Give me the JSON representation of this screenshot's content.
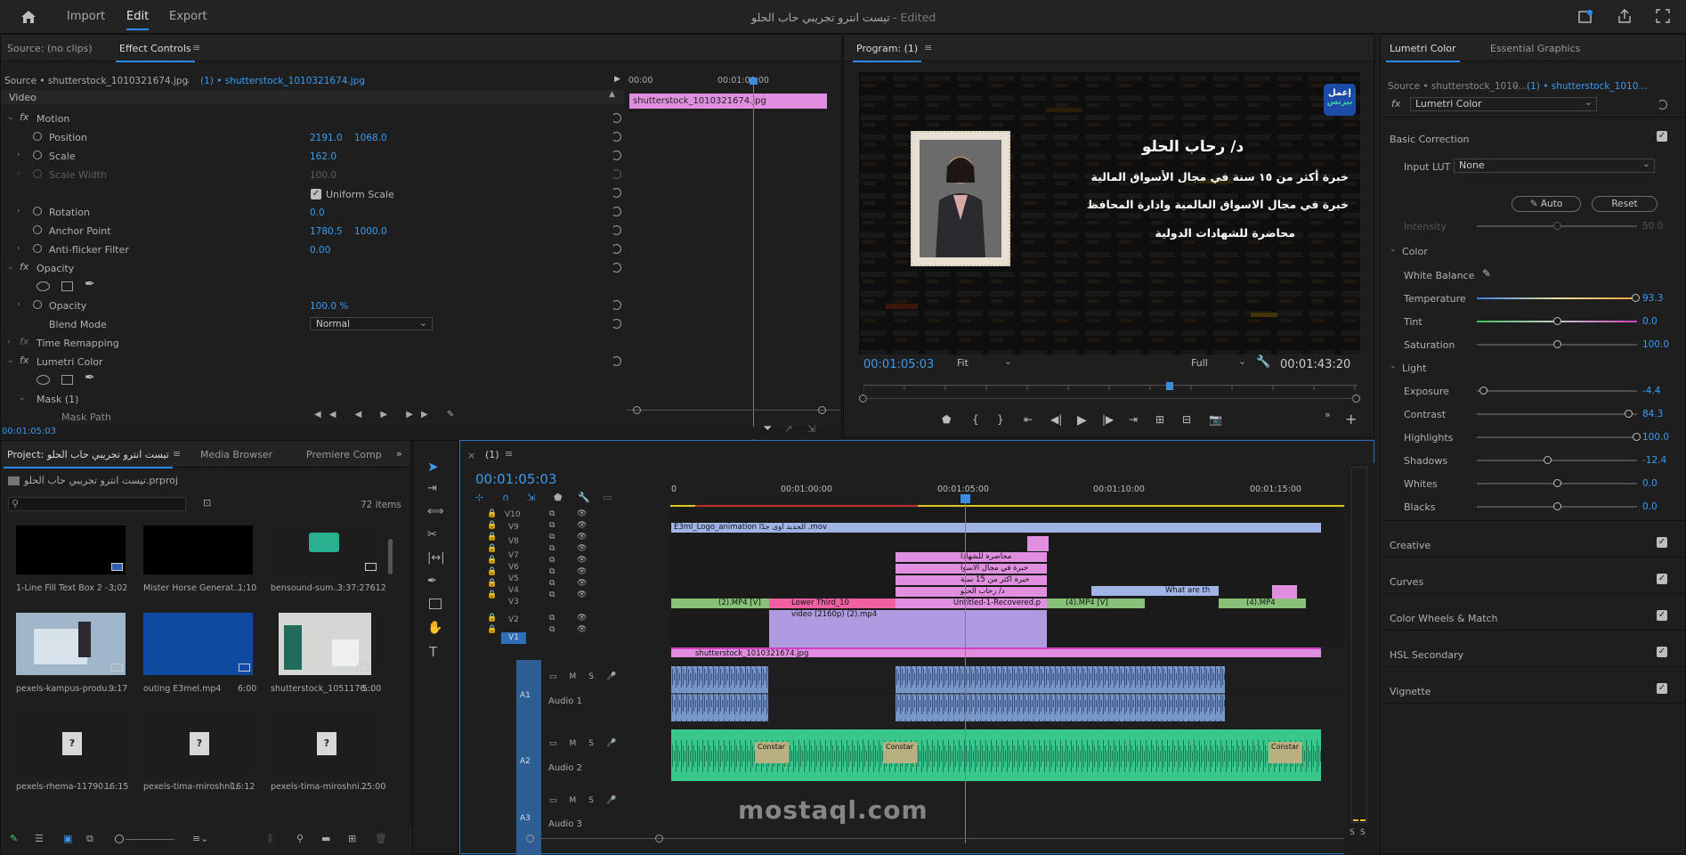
{
  "topbar": {
    "import": "Import",
    "edit": "Edit",
    "export": "Export",
    "title": "تيست انترو تجريبي حاب الحلو",
    "edited": "- Edited"
  },
  "source_panel": {
    "tab_source": "Source: (no clips)",
    "tab_effect": "Effect Controls",
    "source_label": "Source • shutterstock_1010321674.jpg",
    "seq_label": "(1) • shutterstock_1010321674.jpg",
    "time0": "00:00",
    "time1": "00:01:00:00",
    "video": "Video",
    "clip_name": "shutterstock_1010321674.jpg",
    "timecode": "00:01:05:03"
  },
  "effects": {
    "motion": "Motion",
    "position": "Position",
    "pos_x": "2191.0",
    "pos_y": "1068.0",
    "scale": "Scale",
    "scale_v": "162.0",
    "scale_width": "Scale Width",
    "scale_width_v": "100.0",
    "uniform": "Uniform Scale",
    "rotation": "Rotation",
    "rotation_v": "0.0",
    "anchor": "Anchor Point",
    "anchor_x": "1780.5",
    "anchor_y": "1000.0",
    "flicker": "Anti-flicker Filter",
    "flicker_v": "0.00",
    "opacity_grp": "Opacity",
    "opacity": "Opacity",
    "opacity_v": "100.0 %",
    "blend": "Blend Mode",
    "blend_v": "Normal",
    "remap": "Time Remapping",
    "lumetri": "Lumetri Color",
    "mask": "Mask (1)",
    "mask_path": "Mask Path"
  },
  "program": {
    "title": "Program: (1)",
    "name": "د/ رحاب الحلو",
    "line1": "خبرة أكثر من ١٥ سنة في مجال الأسواق المالية",
    "line2": "خبرة في مجال الاسواق العالمية وادارة المحافظ",
    "line3": "محاضرة للشهادات الدولية",
    "logo1": "إعمل",
    "logo2": "بيزنس",
    "timecode": "00:01:05:03",
    "fit": "Fit",
    "full": "Full",
    "duration": "00:01:43:20"
  },
  "lumetri": {
    "tab1": "Lumetri Color",
    "tab2": "Essential Graphics",
    "source": "Source • shutterstock_1010...",
    "seq": "(1) • shutterstock_1010...",
    "fx": "Lumetri Color",
    "basic": "Basic Correction",
    "input_lut": "Input LUT",
    "lut_v": "None",
    "auto": "Auto",
    "reset": "Reset",
    "intensity": "Intensity",
    "intensity_v": "50.0",
    "color": "Color",
    "white_balance": "White Balance",
    "temperature": "Temperature",
    "temperature_v": "93.3",
    "tint": "Tint",
    "tint_v": "0.0",
    "saturation": "Saturation",
    "saturation_v": "100.0",
    "light": "Light",
    "exposure": "Exposure",
    "exposure_v": "-4.4",
    "contrast": "Contrast",
    "contrast_v": "84.3",
    "highlights": "Highlights",
    "highlights_v": "100.0",
    "shadows": "Shadows",
    "shadows_v": "-12.4",
    "whites": "Whites",
    "whites_v": "0.0",
    "blacks": "Blacks",
    "blacks_v": "0.0",
    "creative": "Creative",
    "curves": "Curves",
    "wheels": "Color Wheels & Match",
    "hsl": "HSL Secondary",
    "vignette": "Vignette"
  },
  "project": {
    "tab1": "Project: تيست انترو تجريبي حاب الحلو",
    "tab2": "Media Browser",
    "tab3": "Premiere Comp",
    "file": "تيست انترو تجريبي حاب الحلو.prproj",
    "items": "72 items",
    "bins": [
      {
        "name": "1-Line Fill Text Box 2 -...",
        "dur": "3;02"
      },
      {
        "name": "Mister Horse Generat...",
        "dur": "1;10"
      },
      {
        "name": "bensound-sum...",
        "dur": "3:37:27612"
      },
      {
        "name": "pexels-kampus-produ...",
        "dur": "9:17"
      },
      {
        "name": "outing E3mel.mp4",
        "dur": "6:00"
      },
      {
        "name": "shutterstock_1051176...",
        "dur": "5:00"
      },
      {
        "name": "pexels-rhema-11790...",
        "dur": "16:15"
      },
      {
        "name": "pexels-tima-miroshni...",
        "dur": "16:12"
      },
      {
        "name": "pexels-tima-miroshni...",
        "dur": "25:00"
      }
    ]
  },
  "timeline": {
    "seq": "(1)",
    "timecode": "00:01:05:03",
    "r0": "0",
    "r1": "00:01:00:00",
    "r2": "00:01:05:00",
    "r3": "00:01:10:00",
    "r4": "00:01:15:00",
    "tracks": {
      "v10": "V10",
      "v9": "V9",
      "v8": "V8",
      "v7": "V7",
      "v6": "V6",
      "v5": "V5",
      "v4": "V4",
      "v3": "V3",
      "v2": "V2",
      "v1": "V1",
      "a1": "A1",
      "a2": "A2",
      "a3": "A3",
      "audio1": "Audio 1",
      "audio2": "Audio 2",
      "audio3": "Audio 3"
    },
    "clips": {
      "v10": "E3ml_Logo_animation الجديد أوى جدًا .mov",
      "v7": "محاضرة للشهادا",
      "v6": "خبرة في مجال الاسوا",
      "v5": "خبرة أكثر من 15 سنة",
      "v4": "د/ رحاب الحلو",
      "v3a": "(2).MP4 [V]",
      "v3b": "Lower Third_10",
      "v3c": "Untitled-1-Recovered.p",
      "v3d": "(4).MP4 [V]",
      "v3e": "What are th",
      "v3f": "(4).MP4",
      "v2": "video (2160p) (2).mp4",
      "v1": "shutterstock_1010321674.jpg",
      "constant": "Constar"
    },
    "watermark": "mostaql.com"
  }
}
